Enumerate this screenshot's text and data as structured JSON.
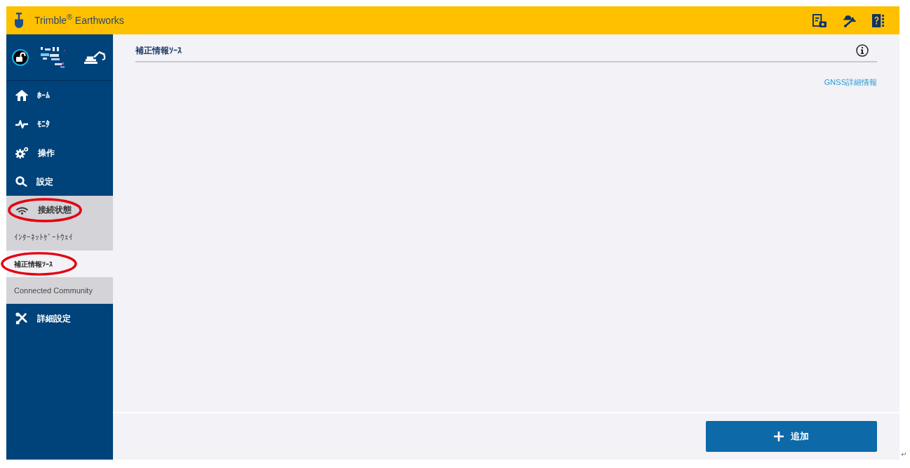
{
  "header": {
    "app_name": "Trimble$^{®}$ Earthworks"
  },
  "sidebar": {
    "items": [
      {
        "label": "ﾎｰﾑ",
        "expanded": false,
        "circled": false
      },
      {
        "label": "ﾓﾆﾀ",
        "expanded": false,
        "circled": false
      },
      {
        "label": "操作",
        "expanded": false,
        "circled": false
      },
      {
        "label": "設定",
        "expanded": false,
        "circled": false
      },
      {
        "label": "接続状態",
        "expanded": true,
        "circled": true,
        "children": [
          {
            "label": "ｲﾝﾀｰﾈｯﾄｹﾞｰﾄｳｪｲ",
            "selected": false,
            "circled": false
          },
          {
            "label": "補正情報ｿｰｽ",
            "selected": true,
            "circled": true
          },
          {
            "label": "Connected Community",
            "selected": false,
            "circled": false
          }
        ]
      },
      {
        "label": "詳細設定",
        "expanded": false,
        "circled": false
      }
    ]
  },
  "content": {
    "title": "補正情報ｿｰｽ",
    "link": "GNSS詳細情報",
    "add_button": "追加"
  },
  "paragraph_mark": "↵"
}
